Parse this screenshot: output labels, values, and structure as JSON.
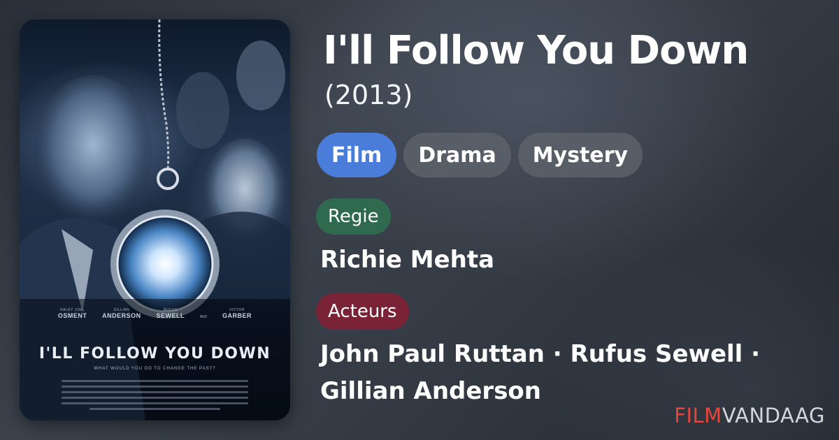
{
  "movie": {
    "title": "I'll Follow You Down",
    "year": "(2013)"
  },
  "genres": [
    "Film",
    "Drama",
    "Mystery"
  ],
  "director": {
    "label": "Regie",
    "name": "Richie Mehta"
  },
  "actors": {
    "label": "Acteurs",
    "names": "John Paul Ruttan · Rufus Sewell · Gillian Anderson"
  },
  "poster": {
    "cast": [
      {
        "first": "HALEY JOEL",
        "last": "OSMENT"
      },
      {
        "first": "GILLIAN",
        "last": "ANDERSON"
      },
      {
        "first": "RUFUS",
        "last": "SEWELL"
      },
      {
        "first": "VICTOR",
        "last": "GARBER"
      }
    ],
    "cast_and": "AND",
    "title": "I'LL FOLLOW YOU DOWN",
    "tagline": "WHAT WOULD YOU DO TO CHANGE THE PAST?"
  },
  "brand": {
    "part1": "FILM",
    "part2": "VANDAAG"
  },
  "colors": {
    "film_pill": "#4a7dd9",
    "genre_pill": "#5f646c",
    "regie_label": "#2f6a4e",
    "acteurs_label": "#7a2236",
    "brand_red": "#e4463b"
  }
}
